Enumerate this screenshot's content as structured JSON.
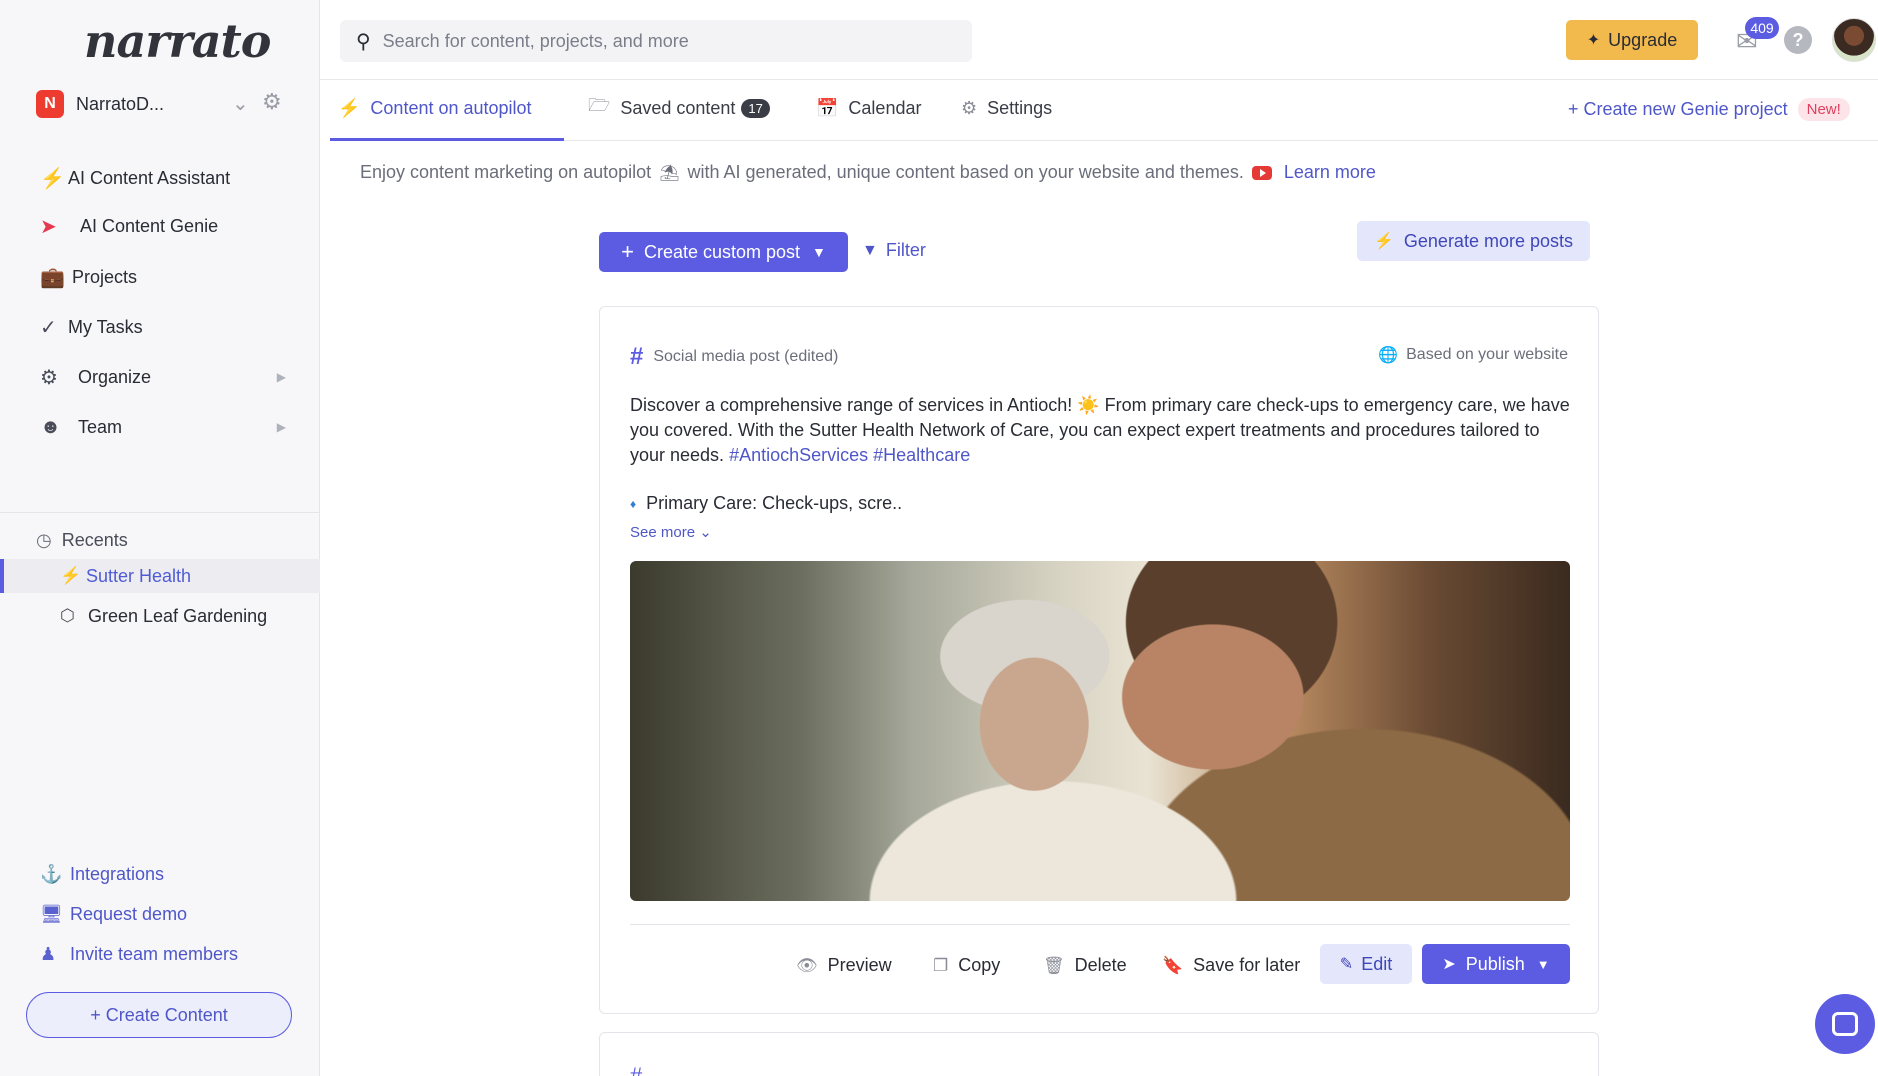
{
  "brand": {
    "logo_text": "narrato"
  },
  "workspace": {
    "initial": "N",
    "name": "NarratoD..."
  },
  "nav": {
    "items": [
      {
        "label": "AI Content Assistant",
        "icon": "lightning-icon"
      },
      {
        "label": "AI Content Genie",
        "icon": "rocket-icon"
      },
      {
        "label": "Projects",
        "icon": "briefcase-icon"
      },
      {
        "label": "My Tasks",
        "icon": "checkmarks-icon"
      },
      {
        "label": "Organize",
        "icon": "gears-icon"
      },
      {
        "label": "Team",
        "icon": "team-icon"
      }
    ]
  },
  "recents": {
    "label": "Recents",
    "items": [
      {
        "label": "Sutter Health",
        "icon": "lightning-icon",
        "active": true
      },
      {
        "label": "Green Leaf Gardening",
        "icon": "cube-icon",
        "active": false
      }
    ]
  },
  "bottom_links": {
    "integrations": "Integrations",
    "request_demo": "Request demo",
    "invite": "Invite team members",
    "create_content": "+ Create Content"
  },
  "topbar": {
    "search_placeholder": "Search for content, projects, and more",
    "upgrade_label": "Upgrade",
    "mail_count": "409",
    "help_label": "?"
  },
  "tabs": {
    "autopilot": "Content on autopilot",
    "saved": "Saved content",
    "saved_count": "17",
    "calendar": "Calendar",
    "settings": "Settings",
    "new_genie": "+ Create new Genie project",
    "new_badge": "New!"
  },
  "intro": {
    "text_before": "Enjoy content marketing on autopilot",
    "text_after": "with AI generated, unique content based on your website and themes.",
    "learn_more": "Learn more"
  },
  "actions": {
    "create_custom_post": "Create custom post",
    "filter": "Filter",
    "generate_more": "Generate more posts"
  },
  "post": {
    "type": "Social media post (edited)",
    "source": "Based on your website",
    "body": "Discover a comprehensive range of services in Antioch! ☀️ From primary care check-ups to emergency care, we have you covered. With the Sutter Health Network of Care, you can expect expert treatments and procedures tailored to your needs.",
    "hashtags": "#AntiochServices #Healthcare",
    "bullet": "Primary Care: Check-ups, scre..",
    "see_more": "See more",
    "buttons": {
      "preview": "Preview",
      "copy": "Copy",
      "delete": "Delete",
      "save_later": "Save for later",
      "edit": "Edit",
      "publish": "Publish"
    }
  },
  "colors": {
    "accent": "#5b5ce2",
    "upgrade": "#f2b94c",
    "workspace_badge": "#ee3b2f"
  }
}
